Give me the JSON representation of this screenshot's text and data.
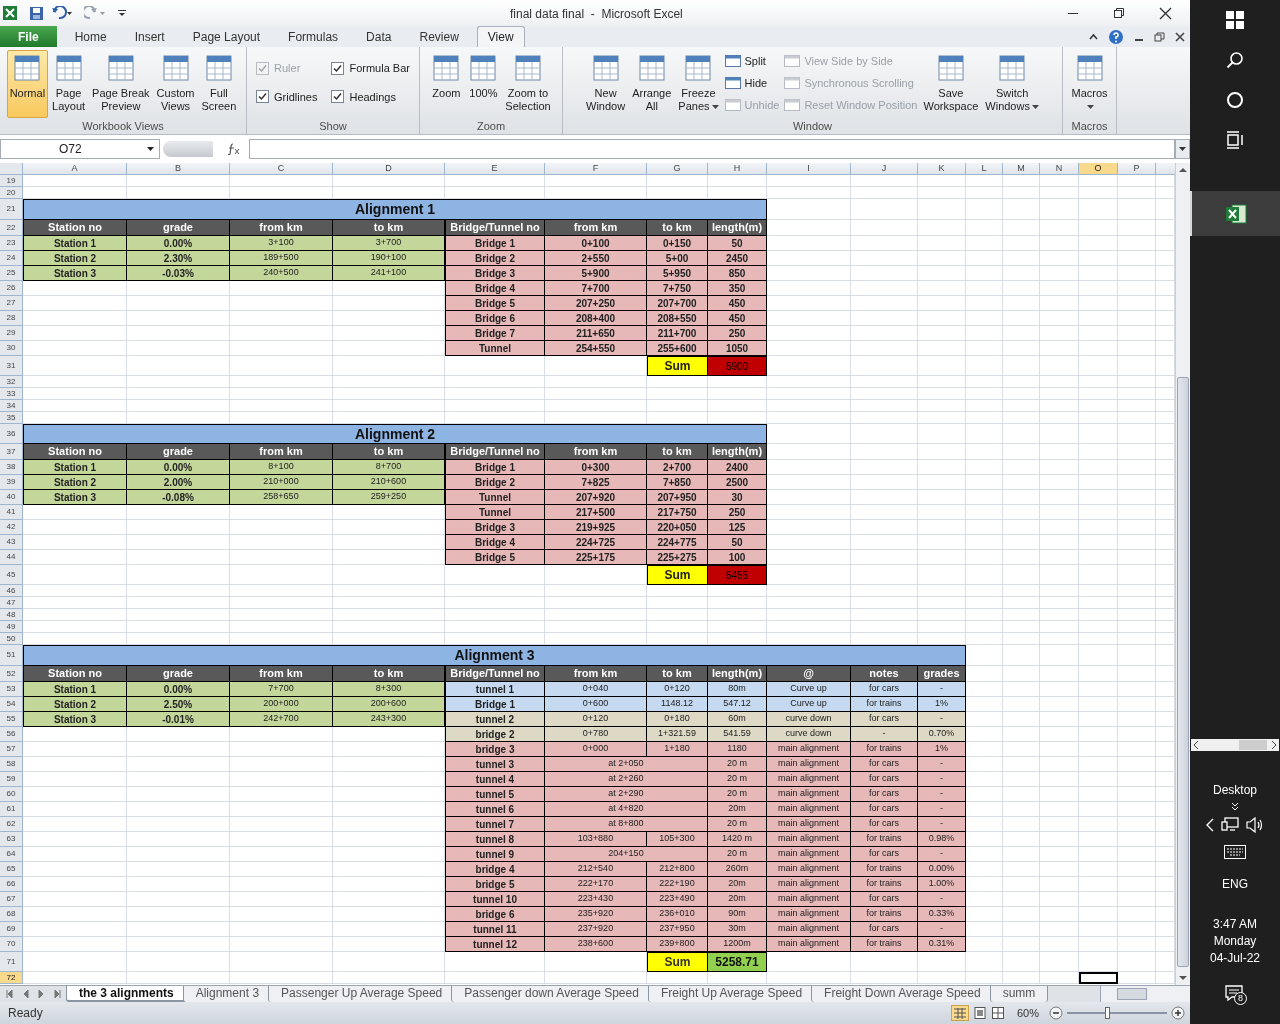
{
  "window": {
    "title": "final data final  -  Microsoft Excel"
  },
  "ribbon_tabs": [
    {
      "label": "File",
      "selected": false,
      "kind": "file"
    },
    {
      "label": "Home",
      "selected": false,
      "kind": "tab"
    },
    {
      "label": "Insert",
      "selected": false,
      "kind": "tab"
    },
    {
      "label": "Page Layout",
      "selected": false,
      "kind": "tab"
    },
    {
      "label": "Formulas",
      "selected": false,
      "kind": "tab"
    },
    {
      "label": "Data",
      "selected": false,
      "kind": "tab"
    },
    {
      "label": "Review",
      "selected": false,
      "kind": "tab"
    },
    {
      "label": "View",
      "selected": true,
      "kind": "tab"
    }
  ],
  "ribbon_groups": [
    {
      "label": "Workbook Views",
      "items": [
        {
          "kind": "large",
          "label": "Normal",
          "selected": true
        },
        {
          "kind": "large",
          "label": "Page\nLayout",
          "selected": false
        },
        {
          "kind": "large",
          "label": "Page Break\nPreview",
          "selected": false
        },
        {
          "kind": "large",
          "label": "Custom\nViews",
          "selected": false
        },
        {
          "kind": "large",
          "label": "Full\nScreen",
          "selected": false
        }
      ]
    },
    {
      "label": "Show",
      "items": [
        {
          "kind": "check",
          "label": "Ruler",
          "checked": true,
          "disabled": true
        },
        {
          "kind": "check",
          "label": "Formula Bar",
          "checked": true,
          "disabled": false
        },
        {
          "kind": "check",
          "label": "Gridlines",
          "checked": true,
          "disabled": false
        },
        {
          "kind": "check",
          "label": "Headings",
          "checked": true,
          "disabled": false
        }
      ]
    },
    {
      "label": "Zoom",
      "items": [
        {
          "kind": "large",
          "label": "Zoom"
        },
        {
          "kind": "large",
          "label": "100%"
        },
        {
          "kind": "large",
          "label": "Zoom to\nSelection"
        }
      ]
    },
    {
      "label": "Window",
      "items": [
        {
          "kind": "large",
          "label": "New\nWindow",
          "dropdown": false
        },
        {
          "kind": "large",
          "label": "Arrange\nAll",
          "dropdown": false
        },
        {
          "kind": "large",
          "label": "Freeze\nPanes",
          "dropdown": true
        },
        {
          "kind": "small",
          "label": "Split",
          "disabled": false
        },
        {
          "kind": "small",
          "label": "Hide",
          "disabled": false
        },
        {
          "kind": "small",
          "label": "Unhide",
          "disabled": true
        },
        {
          "kind": "small",
          "label": "View Side by Side",
          "disabled": true
        },
        {
          "kind": "small",
          "label": "Synchronous Scrolling",
          "disabled": true
        },
        {
          "kind": "small",
          "label": "Reset Window Position",
          "disabled": true
        },
        {
          "kind": "large",
          "label": "Save\nWorkspace",
          "dropdown": false
        },
        {
          "kind": "large",
          "label": "Switch\nWindows",
          "dropdown": true
        }
      ]
    },
    {
      "label": "Macros",
      "items": [
        {
          "kind": "large",
          "label": "Macros",
          "dropdown": true
        }
      ]
    }
  ],
  "formula_bar": {
    "name_box": "O72"
  },
  "column_headers": [
    {
      "label": "A",
      "selected": false
    },
    {
      "label": "B",
      "selected": false
    },
    {
      "label": "C",
      "selected": false
    },
    {
      "label": "D",
      "selected": false
    },
    {
      "label": "E",
      "selected": false
    },
    {
      "label": "F",
      "selected": false
    },
    {
      "label": "G",
      "selected": false
    },
    {
      "label": "H",
      "selected": false
    },
    {
      "label": "I",
      "selected": false
    },
    {
      "label": "J",
      "selected": false
    },
    {
      "label": "K",
      "selected": false
    },
    {
      "label": "L",
      "selected": false
    },
    {
      "label": "M",
      "selected": false
    },
    {
      "label": "N",
      "selected": false
    },
    {
      "label": "O",
      "selected": true
    },
    {
      "label": "P",
      "selected": false
    }
  ],
  "row_numbers": [
    {
      "label": "19",
      "selected": false
    },
    {
      "label": "20",
      "selected": false
    },
    {
      "label": "21",
      "selected": false
    },
    {
      "label": "22",
      "selected": false
    },
    {
      "label": "23",
      "selected": false
    },
    {
      "label": "24",
      "selected": false
    },
    {
      "label": "25",
      "selected": false
    },
    {
      "label": "26",
      "selected": false
    },
    {
      "label": "27",
      "selected": false
    },
    {
      "label": "28",
      "selected": false
    },
    {
      "label": "29",
      "selected": false
    },
    {
      "label": "30",
      "selected": false
    },
    {
      "label": "31",
      "selected": false
    },
    {
      "label": "32",
      "selected": false
    },
    {
      "label": "33",
      "selected": false
    },
    {
      "label": "34",
      "selected": false
    },
    {
      "label": "35",
      "selected": false
    },
    {
      "label": "36",
      "selected": false
    },
    {
      "label": "37",
      "selected": false
    },
    {
      "label": "38",
      "selected": false
    },
    {
      "label": "39",
      "selected": false
    },
    {
      "label": "40",
      "selected": false
    },
    {
      "label": "41",
      "selected": false
    },
    {
      "label": "42",
      "selected": false
    },
    {
      "label": "43",
      "selected": false
    },
    {
      "label": "44",
      "selected": false
    },
    {
      "label": "45",
      "selected": false
    },
    {
      "label": "46",
      "selected": false
    },
    {
      "label": "47",
      "selected": false
    },
    {
      "label": "48",
      "selected": false
    },
    {
      "label": "49",
      "selected": false
    },
    {
      "label": "50",
      "selected": false
    },
    {
      "label": "51",
      "selected": false
    },
    {
      "label": "52",
      "selected": false
    },
    {
      "label": "53",
      "selected": false
    },
    {
      "label": "54",
      "selected": false
    },
    {
      "label": "55",
      "selected": false
    },
    {
      "label": "56",
      "selected": false
    },
    {
      "label": "57",
      "selected": false
    },
    {
      "label": "58",
      "selected": false
    },
    {
      "label": "59",
      "selected": false
    },
    {
      "label": "60",
      "selected": false
    },
    {
      "label": "61",
      "selected": false
    },
    {
      "label": "62",
      "selected": false
    },
    {
      "label": "63",
      "selected": false
    },
    {
      "label": "64",
      "selected": false
    },
    {
      "label": "65",
      "selected": false
    },
    {
      "label": "66",
      "selected": false
    },
    {
      "label": "67",
      "selected": false
    },
    {
      "label": "68",
      "selected": false
    },
    {
      "label": "69",
      "selected": false
    },
    {
      "label": "70",
      "selected": false
    },
    {
      "label": "71",
      "selected": false
    },
    {
      "label": "72",
      "selected": true
    }
  ],
  "tables": [
    {
      "title": "Alignment 1",
      "columns": [
        "Station no",
        "grade",
        "from km",
        "to km",
        "Bridge/Tunnel no",
        "from km",
        "to km",
        "length(m)"
      ],
      "stations": [
        {
          "name": "Station 1",
          "grade": "0.00%",
          "from_km": "3+100",
          "to_km": "3+700"
        },
        {
          "name": "Station 2",
          "grade": "2.30%",
          "from_km": "189+500",
          "to_km": "190+100"
        },
        {
          "name": "Station 3",
          "grade": "-0.03%",
          "from_km": "240+500",
          "to_km": "241+100"
        }
      ],
      "structures": [
        {
          "kind": "range",
          "name": "Bridge 1",
          "from_km": "0+100",
          "to_km": "0+150",
          "length": "50",
          "color": "#e6b8b7"
        },
        {
          "kind": "range",
          "name": "Bridge 2",
          "from_km": "2+550",
          "to_km": "5+00",
          "length": "2450",
          "color": "#e6b8b7"
        },
        {
          "kind": "range",
          "name": "Bridge 3",
          "from_km": "5+900",
          "to_km": "5+950",
          "length": "850",
          "color": "#e6b8b7"
        },
        {
          "kind": "range",
          "name": "Bridge 4",
          "from_km": "7+700",
          "to_km": "7+750",
          "length": "350",
          "color": "#e6b8b7"
        },
        {
          "kind": "range",
          "name": "Bridge 5",
          "from_km": "207+250",
          "to_km": "207+700",
          "length": "450",
          "color": "#e6b8b7"
        },
        {
          "kind": "range",
          "name": "Bridge 6",
          "from_km": "208+400",
          "to_km": "208+550",
          "length": "450",
          "color": "#e6b8b7"
        },
        {
          "kind": "range",
          "name": "Bridge 7",
          "from_km": "211+650",
          "to_km": "211+700",
          "length": "250",
          "color": "#e6b8b7"
        },
        {
          "kind": "range",
          "name": "Tunnel",
          "from_km": "254+550",
          "to_km": "255+600",
          "length": "1050",
          "color": "#e6b8b7"
        }
      ],
      "sum": {
        "label": "Sum",
        "value": "5900",
        "color": "#c00000"
      }
    },
    {
      "title": "Alignment 2",
      "columns": [
        "Station no",
        "grade",
        "from km",
        "to km",
        "Bridge/Tunnel no",
        "from km",
        "to km",
        "length(m)"
      ],
      "stations": [
        {
          "name": "Station 1",
          "grade": "0.00%",
          "from_km": "8+100",
          "to_km": "8+700"
        },
        {
          "name": "Station 2",
          "grade": "2.00%",
          "from_km": "210+000",
          "to_km": "210+600"
        },
        {
          "name": "Station 3",
          "grade": "-0.08%",
          "from_km": "258+650",
          "to_km": "259+250"
        }
      ],
      "structures": [
        {
          "kind": "range",
          "name": "Bridge 1",
          "from_km": "0+300",
          "to_km": "2+700",
          "length": "2400",
          "color": "#e6b8b7"
        },
        {
          "kind": "range",
          "name": "Bridge 2",
          "from_km": "7+825",
          "to_km": "7+850",
          "length": "2500",
          "color": "#e6b8b7"
        },
        {
          "kind": "range",
          "name": "Tunnel",
          "from_km": "207+920",
          "to_km": "207+950",
          "length": "30",
          "color": "#e6b8b7"
        },
        {
          "kind": "range",
          "name": "Tunnel",
          "from_km": "217+500",
          "to_km": "217+750",
          "length": "250",
          "color": "#e6b8b7"
        },
        {
          "kind": "range",
          "name": "Bridge 3",
          "from_km": "219+925",
          "to_km": "220+050",
          "length": "125",
          "color": "#e6b8b7"
        },
        {
          "kind": "range",
          "name": "Bridge 4",
          "from_km": "224+725",
          "to_km": "224+775",
          "length": "50",
          "color": "#e6b8b7"
        },
        {
          "kind": "range",
          "name": "Bridge 5",
          "from_km": "225+175",
          "to_km": "225+275",
          "length": "100",
          "color": "#e6b8b7"
        }
      ],
      "sum": {
        "label": "Sum",
        "value": "5455",
        "color": "#c00000"
      }
    },
    {
      "title": "Alignment 3",
      "columns": [
        "Station no",
        "grade",
        "from km",
        "to km",
        "Bridge/Tunnel no",
        "from km",
        "to km",
        "length(m)",
        "@",
        "notes",
        "grades"
      ],
      "stations": [
        {
          "name": "Station 1",
          "grade": "0.00%",
          "from_km": "7+700",
          "to_km": "8+300"
        },
        {
          "name": "Station 2",
          "grade": "2.50%",
          "from_km": "200+000",
          "to_km": "200+600"
        },
        {
          "name": "Station 3",
          "grade": "-0.01%",
          "from_km": "242+700",
          "to_km": "243+300"
        }
      ],
      "structures": [
        {
          "kind": "range",
          "name": "tunnel 1",
          "from_km": "0+040",
          "to_km": "0+120",
          "length": "80m",
          "at": "Curve up",
          "notes": "for cars",
          "grades": "-",
          "color": "#c5d9f1"
        },
        {
          "kind": "range",
          "name": "Bridge 1",
          "from_km": "0+600",
          "to_km": "1148.12",
          "length": "547.12",
          "at": "Curve up",
          "notes": "for trains",
          "grades": "1%",
          "color": "#c5d9f1"
        },
        {
          "kind": "range",
          "name": "tunnel  2",
          "from_km": "0+120",
          "to_km": "0+180",
          "length": "60m",
          "at": "curve down",
          "notes": "for cars",
          "grades": "-",
          "color": "#ddd9c4"
        },
        {
          "kind": "range",
          "name": "bridge 2",
          "from_km": "0+780",
          "to_km": "1+321.59",
          "length": "541.59",
          "at": "curve down",
          "notes": "-",
          "grades": "0.70%",
          "color": "#ddd9c4"
        },
        {
          "kind": "range",
          "name": "bridge 3",
          "from_km": "0+000",
          "to_km": "1+180",
          "length": "1180",
          "at": "main alignment",
          "notes": "for trains",
          "grades": "1%",
          "color": "#e6b8b7"
        },
        {
          "kind": "point",
          "name": "tunnel 3",
          "location": "at 2+050",
          "length": "20 m",
          "at": "main alignment",
          "notes": "for cars",
          "grades": "-",
          "color": "#e6b8b7"
        },
        {
          "kind": "point",
          "name": "tunnel 4",
          "location": "at 2+260",
          "length": "20 m",
          "at": "main alignment",
          "notes": "for cars",
          "grades": "-",
          "color": "#e6b8b7"
        },
        {
          "kind": "point",
          "name": "tunnel 5",
          "location": "at 2+290",
          "length": "20 m",
          "at": "main alignment",
          "notes": "for cars",
          "grades": "-",
          "color": "#e6b8b7"
        },
        {
          "kind": "point",
          "name": "tunnel 6",
          "location": "at 4+820",
          "length": "20m",
          "at": "main alignment",
          "notes": "for cars",
          "grades": "-",
          "color": "#e6b8b7"
        },
        {
          "kind": "point",
          "name": "tunnel 7",
          "location": "at 8+800",
          "length": "20 m",
          "at": "main alignment",
          "notes": "for cars",
          "grades": "-",
          "color": "#e6b8b7"
        },
        {
          "kind": "range",
          "name": "tunnel 8",
          "from_km": "103+880",
          "to_km": "105+300",
          "length": "1420 m",
          "at": "main alignment",
          "notes": "for trains",
          "grades": "0.98%",
          "color": "#e6b8b7"
        },
        {
          "kind": "point",
          "name": "tunnel 9",
          "location": "204+150",
          "length": "20 m",
          "at": "main alignment",
          "notes": "for cars",
          "grades": "-",
          "color": "#e6b8b7"
        },
        {
          "kind": "range",
          "name": "bridge 4",
          "from_km": "212+540",
          "to_km": "212+800",
          "length": "260m",
          "at": "main alignment",
          "notes": "for trains",
          "grades": "0.00%",
          "color": "#e6b8b7"
        },
        {
          "kind": "range",
          "name": "bridge 5",
          "from_km": "222+170",
          "to_km": "222+190",
          "length": "20m",
          "at": "main alignment",
          "notes": "for trains",
          "grades": "1.00%",
          "color": "#e6b8b7"
        },
        {
          "kind": "range",
          "name": "tunnel 10",
          "from_km": "223+430",
          "to_km": "223+490",
          "length": "20m",
          "at": "main alignment",
          "notes": "for cars",
          "grades": "-",
          "color": "#e6b8b7"
        },
        {
          "kind": "range",
          "name": "bridge 6",
          "from_km": "235+920",
          "to_km": "236+010",
          "length": "90m",
          "at": "main alignment",
          "notes": "for trains",
          "grades": "0.33%",
          "color": "#e6b8b7"
        },
        {
          "kind": "range",
          "name": "tunnel 11",
          "from_km": "237+920",
          "to_km": "237+950",
          "length": "30m",
          "at": "main alignment",
          "notes": "for cars",
          "grades": "-",
          "color": "#e6b8b7"
        },
        {
          "kind": "range",
          "name": "tunnel 12",
          "from_km": "238+600",
          "to_km": "239+800",
          "length": "1200m",
          "at": "main alignment",
          "notes": "for trains",
          "grades": "0.31%",
          "color": "#e6b8b7"
        }
      ],
      "sum": {
        "label": "Sum",
        "value": "5258.71",
        "color": "#92d050"
      }
    }
  ],
  "sheet_tabs": [
    {
      "label": "the 3 alignments",
      "selected": true
    },
    {
      "label": "Alignment 3",
      "selected": false
    },
    {
      "label": "Passenger Up Average Speed",
      "selected": false
    },
    {
      "label": "Passenger down Average Speed",
      "selected": false
    },
    {
      "label": "Freight Up Average Speed",
      "selected": false
    },
    {
      "label": "Freight Down Average Speed",
      "selected": false
    },
    {
      "label": "summ",
      "selected": false
    }
  ],
  "status_bar": {
    "status": "Ready",
    "zoom": "60%",
    "zoom_slider": {
      "level": 0.4
    }
  },
  "side_panel": {
    "desktop": "Desktop",
    "language": "ENG",
    "time": "3:47 AM",
    "day": "Monday",
    "date": "04-Jul-22",
    "notifications": "8"
  }
}
